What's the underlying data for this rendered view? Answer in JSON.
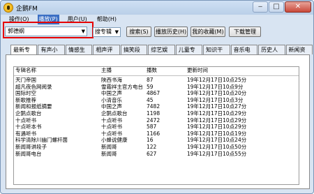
{
  "window": {
    "title": "企鹅FM",
    "min": "‒",
    "max": "□",
    "close": "✕"
  },
  "menu": [
    {
      "label": "操作(O)"
    },
    {
      "label": "播放(P)"
    },
    {
      "label": "用户(U)"
    },
    {
      "label": "帮助(H)"
    }
  ],
  "toolbar": {
    "search_value": "郭德纲",
    "mode_value": "搜专辑",
    "search_button": "搜索(S)",
    "history_button": "播放历史(H)",
    "favorites_button": "我的收藏(M)",
    "download_button": "下载管理"
  },
  "tabs": [
    "最新专辑",
    "有声小说",
    "情感生活",
    "相声评书",
    "搞笑段子",
    "综艺娱乐",
    "儿童专区",
    "知识干货",
    "音乐电台",
    "历史人文",
    "新闻资讯"
  ],
  "table": {
    "columns": [
      "专辑名称",
      "主播",
      "播数",
      "更新时间"
    ],
    "rows": [
      [
        "天门帝国",
        "陕西书海",
        "87",
        "19年12月17日10点25分"
      ],
      [
        "超凡夜色网阅录",
        "雪霜祥主官方电台",
        "59",
        "19年12月17日10点9分"
      ],
      [
        "国际时空",
        "中国之声",
        "4867",
        "19年12月17日10点20分"
      ],
      [
        "新歌推荐",
        "小清音乐",
        "45",
        "19年12月17日10点3分"
      ],
      [
        "新闻和报纸摘要",
        "中国之声",
        "7482",
        "19年12月17日10点27分"
      ],
      [
        "企鹅点歌台",
        "企鹅点歌台",
        "1198",
        "19年12月17日10点29分"
      ],
      [
        "十点听书",
        "十点听书",
        "2472",
        "19年12月17日10点29分"
      ],
      [
        "十点听本书",
        "十点听书",
        "587",
        "19年12月17日10点29分"
      ],
      [
        "有遇听书",
        "十点听书",
        "1166",
        "19年12月17日10点19分"
      ],
      [
        "科学清除川幽门螺杆菌",
        "小蜂说健康",
        "16",
        "19年12月17日10点24分"
      ],
      [
        "新闻哥讲段子",
        "新闻哥",
        "122",
        "19年12月17日10点50分"
      ],
      [
        "新闻哥电台",
        "新闻哥",
        "627",
        "19年12月17日10点55分"
      ]
    ]
  }
}
